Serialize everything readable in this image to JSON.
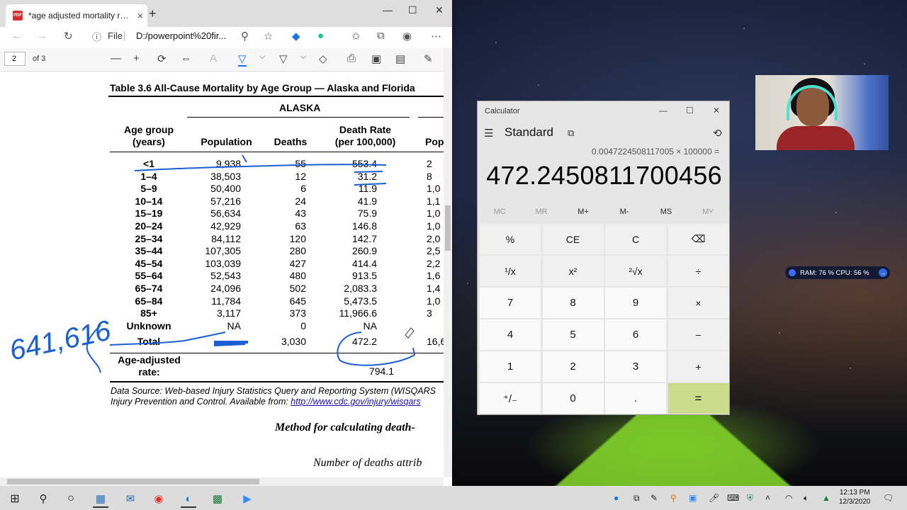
{
  "browser": {
    "tab_title": "*age adjusted mortality rates, de",
    "tab_close": "×",
    "new_tab": "+",
    "window_min": "—",
    "window_max": "☐",
    "window_close": "✕",
    "file_label": "File",
    "url": "D:/powerpoint%20fir...",
    "pdf_page": "2",
    "pdf_total": "of 3"
  },
  "document": {
    "title": "Table 3.6 All-Cause Mortality by Age Group — Alaska and Florida",
    "alaska": "ALASKA",
    "headers": {
      "age_group": "Age group\n(years)",
      "population": "Population",
      "deaths": "Deaths",
      "death_rate": "Death Rate\n(per 100,000)",
      "population2": "Pop"
    },
    "rows": [
      {
        "age": "<1",
        "pop": "9,938",
        "deaths": "55",
        "rate": "553.4",
        "pop2": "2"
      },
      {
        "age": "1–4",
        "pop": "38,503",
        "deaths": "12",
        "rate": "31.2",
        "pop2": "8"
      },
      {
        "age": "5–9",
        "pop": "50,400",
        "deaths": "6",
        "rate": "11.9",
        "pop2": "1,0"
      },
      {
        "age": "10–14",
        "pop": "57,216",
        "deaths": "24",
        "rate": "41.9",
        "pop2": "1,1"
      },
      {
        "age": "15–19",
        "pop": "56,634",
        "deaths": "43",
        "rate": "75.9",
        "pop2": "1,0"
      },
      {
        "age": "20–24",
        "pop": "42,929",
        "deaths": "63",
        "rate": "146.8",
        "pop2": "1,0"
      },
      {
        "age": "25–34",
        "pop": "84,112",
        "deaths": "120",
        "rate": "142.7",
        "pop2": "2,0"
      },
      {
        "age": "35–44",
        "pop": "107,305",
        "deaths": "280",
        "rate": "260.9",
        "pop2": "2,5"
      },
      {
        "age": "45–54",
        "pop": "103,039",
        "deaths": "427",
        "rate": "414.4",
        "pop2": "2,2"
      },
      {
        "age": "55–64",
        "pop": "52,543",
        "deaths": "480",
        "rate": "913.5",
        "pop2": "1,6"
      },
      {
        "age": "65–74",
        "pop": "24,096",
        "deaths": "502",
        "rate": "2,083.3",
        "pop2": "1,4"
      },
      {
        "age": "65–84",
        "pop": "11,784",
        "deaths": "645",
        "rate": "5,473.5",
        "pop2": "1,0"
      },
      {
        "age": "85+",
        "pop": "3,117",
        "deaths": "373",
        "rate": "11,966.6",
        "pop2": "3"
      },
      {
        "age": "Unknown",
        "pop": "NA",
        "deaths": "0",
        "rate": "NA",
        "pop2": ""
      }
    ],
    "total": {
      "age": "Total",
      "pop": "",
      "deaths": "3,030",
      "rate": "472.2",
      "pop2": "16,6"
    },
    "adjusted_label": "Age-adjusted\nrate:",
    "adjusted_value": "794.1",
    "source_line1": "Data Source: Web-based Injury Statistics Query and Reporting System (WISQARS",
    "source_line2_prefix": "Injury Prevention and Control. Available from: ",
    "source_link": "http://www.cdc.gov/injury/wisqars",
    "method": "Method for calculating death-",
    "number_of_deaths": "Number of deaths attrib",
    "handwriting": "641,616"
  },
  "calculator": {
    "title": "Calculator",
    "mode": "Standard",
    "expression": "0.0047224508117005 × 100000 =",
    "result": "472.2450811700456",
    "memory": [
      "MC",
      "MR",
      "M+",
      "M-",
      "MS",
      "M˅"
    ],
    "keys": [
      [
        "%",
        "CE",
        "C",
        "⌫"
      ],
      [
        "¹/x",
        "x²",
        "²√x",
        "÷"
      ],
      [
        "7",
        "8",
        "9",
        "×"
      ],
      [
        "4",
        "5",
        "6",
        "−"
      ],
      [
        "1",
        "2",
        "3",
        "+"
      ],
      [
        "⁺/₋",
        "0",
        ".",
        "="
      ]
    ]
  },
  "perf_widget": "RAM: 76 %  CPU: 56 %",
  "clock": {
    "time": "12:13 PM",
    "date": "12/3/2020"
  }
}
